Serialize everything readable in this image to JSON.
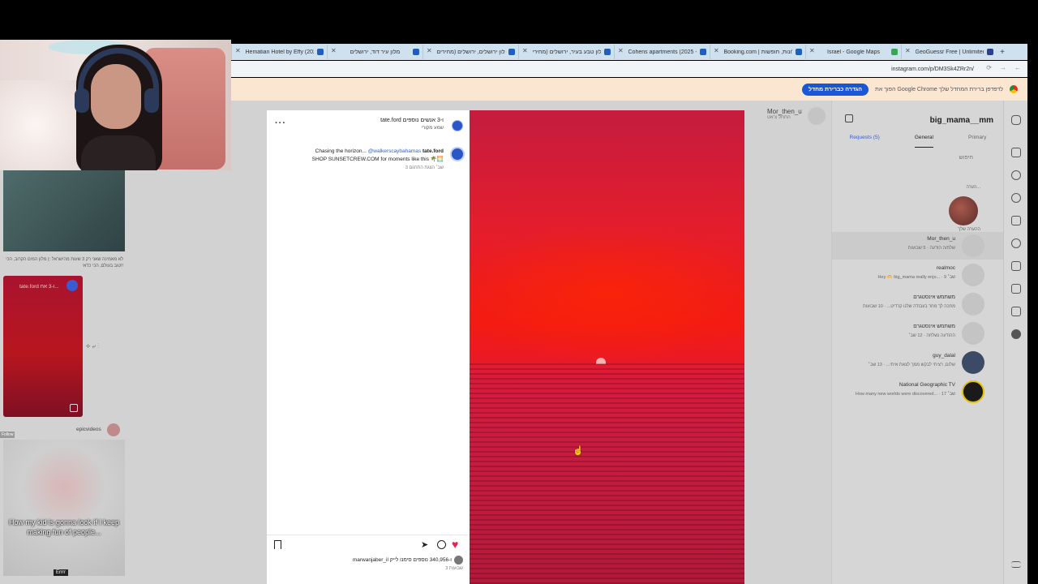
{
  "browser": {
    "tabs": [
      {
        "title": "Hematian Hotel by Effy (2025 -"
      },
      {
        "title": "מלון עיר דוד, ירושלים"
      },
      {
        "title": "מלון ירושלים, ירושלים (מחירים"
      },
      {
        "title": "מלון טבע בעיר, ירושלים (מחירי"
      },
      {
        "title": "Cohens apartments (2025 - מ"
      },
      {
        "title": "Booking.com | מלונות, חופשות"
      },
      {
        "title": "Israel - Google Maps"
      },
      {
        "title": "GeoGuessr Free | Unlimited M"
      }
    ],
    "new_tab": "+",
    "url": "instagram.com/p/DM3Sk4ZRr2n/",
    "infobar": {
      "text": "הפוך את Google Chrome לדפדפן ברירת המחדל שלך",
      "button": "הגדרה כברירת מחדל"
    }
  },
  "dm_panel": {
    "username": "big_mama__mm",
    "tabs": {
      "primary": "Primary",
      "general": "General",
      "requests": "Requests (5)"
    },
    "search_placeholder": "חיפוש",
    "note_label": "הערה...",
    "note_sub": "ההערה שלך",
    "rows": [
      {
        "name": "Mor_then_u",
        "preview": "שלח/ה הודעה · 5 שבועות"
      },
      {
        "name": "realmoc",
        "preview": "Hey 🫶 big_mama really enjo... · 9 שב׳"
      },
      {
        "name": "משתמש אינסטגרם",
        "preview": "מחכה לך מחר בעבודה שלנו קרדיט... · 10 שבועות"
      },
      {
        "name": "משתמש אינסטגרם",
        "preview": "ההודעה נשלחה · 12 שב׳"
      },
      {
        "name": "guy_dalal",
        "preview": "שלום, רציתי לבקש ממך לצאת איתי... · 13 שב׳"
      },
      {
        "name": "National Geographic TV",
        "preview": "How many new worlds were discovered... · 17 שב׳"
      }
    ]
  },
  "main": {
    "user": "Mor_then_u",
    "user_sub": "התחל צ'אט"
  },
  "feed": {
    "caption_1": "לא מאמינה שאני רק 3 שעות מהישראל :) מלון המים הקרוב, הכי טוב בעולם, הכי כדאי!!",
    "reel_title": "tate.ford ו-3 אח...",
    "reel_actions": "⟡ ⤶ ⋮",
    "user_2": "epicvideos",
    "thumb_2_text": "How my kid is gonna look if I keep making fun of people...",
    "thumb_2_tag": "Errrr",
    "left_badge": "Follow"
  },
  "post": {
    "more": "···",
    "header_name": "tate.ford ו-3 אנשים נוספים",
    "header_sub": "שמע מקורי",
    "caption_user": "tate.ford",
    "caption_start": " Chasing the horizon... ",
    "caption_mention": "@walkerscaybahamas",
    "caption_line_2": "SHOP SUNSETCREW.COM for moments like this 🌴🌅",
    "caption_meta": "3 שב׳     הצגת התרגום",
    "likes_text": "marwanjaber_il ו-340,956 נוספים סימנו לייק",
    "time": "3 שבועות",
    "share_glyph": "➤",
    "like_glyph": "♥"
  },
  "cursor_glyph": "☝",
  "colors": {
    "accent": "#1a56d6",
    "like": "#ee1d52",
    "sunset": "#e41d2c"
  }
}
